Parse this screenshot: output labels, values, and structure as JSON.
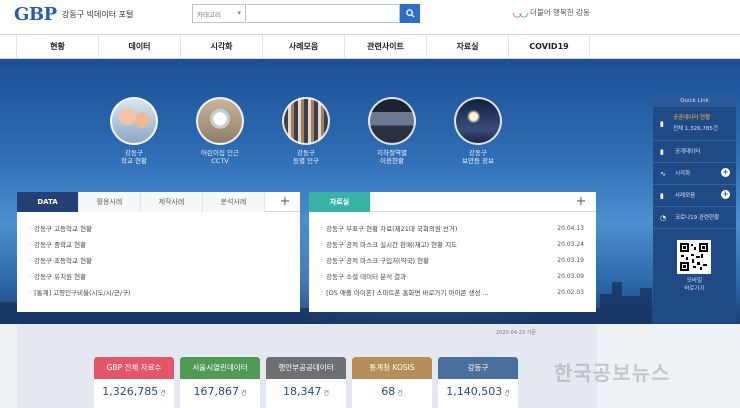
{
  "header": {
    "logo": "GBP",
    "portal_name": "강동구 빅데이터 포털",
    "search_select": "카테고리",
    "search_placeholder": "",
    "brand_mark": "Ꮃ",
    "brand_text": "더불어 행복한 강동"
  },
  "nav": [
    "현황",
    "데이터",
    "시각화",
    "사례모음",
    "관련사이트",
    "자료실",
    "COVID19"
  ],
  "hero": {
    "topics": [
      {
        "label_line1": "강동구",
        "label_line2": "학교 현황"
      },
      {
        "label_line1": "어린이집 인근",
        "label_line2": "CCTV"
      },
      {
        "label_line1": "강동구",
        "label_line2": "동별 인구"
      },
      {
        "label_line1": "지하철역별",
        "label_line2": "이용현황"
      },
      {
        "label_line1": "강동구",
        "label_line2": "보안등 정보"
      }
    ]
  },
  "quick_menu": {
    "title": "Quick Link",
    "highlight_line1": "공공데이터 현황",
    "highlight_line2": "전체 1,326,785건",
    "items": [
      "공개데이터",
      "시각화",
      "사례모음",
      "코로나19 관련현황"
    ],
    "qr_label_line1": "모바일",
    "qr_label_line2": "바로가기"
  },
  "data_panel": {
    "tabs": [
      "DATA",
      "활용사례",
      "제작사례",
      "분석사례"
    ],
    "plus": "+",
    "items": [
      "강동구 고등학교 현황",
      "강동구 중학교 현황",
      "강동구 초등학교 현황",
      "강동구 유치원 현황",
      "[통계] 고령인구비율(시도/시/군/구)"
    ]
  },
  "archive_panel": {
    "tab": "자료실",
    "plus": "+",
    "items": [
      {
        "title": "강동구 부표구 현황 자료(제21대 국회의원 선거)",
        "date": "20.04.13"
      },
      {
        "title": "강동구 공적 마스크 실시간 판매(재고) 현황 지도",
        "date": "20.03.24"
      },
      {
        "title": "강동구 공적 마스크 구입처(약국) 현황",
        "date": "20.03.19"
      },
      {
        "title": "강동구 소셜 데이터 분석 결과",
        "date": "20.03.09"
      },
      {
        "title": "[OS 애플 아이폰] 스마트폰 홈화면 바로가기 아이콘 생성 ...",
        "date": "20.02.03"
      }
    ]
  },
  "updated": "2020-04-23 기준",
  "stats": [
    {
      "label": "GBP 전체 자료수",
      "value": "1,326,785",
      "unit": "건",
      "color": "#e3566a"
    },
    {
      "label": "서울시열린데이터",
      "value": "167,867",
      "unit": "건",
      "color": "#4f9a55"
    },
    {
      "label": "행안부공공데이터",
      "value": "18,347",
      "unit": "건",
      "color": "#6d6f72"
    },
    {
      "label": "통계청 KOSIS",
      "value": "68",
      "unit": "건",
      "color": "#b78e57"
    },
    {
      "label": "강동구",
      "value": "1,140,503",
      "unit": "건",
      "color": "#4a6f9d"
    }
  ],
  "watermark": "한국공보뉴스"
}
